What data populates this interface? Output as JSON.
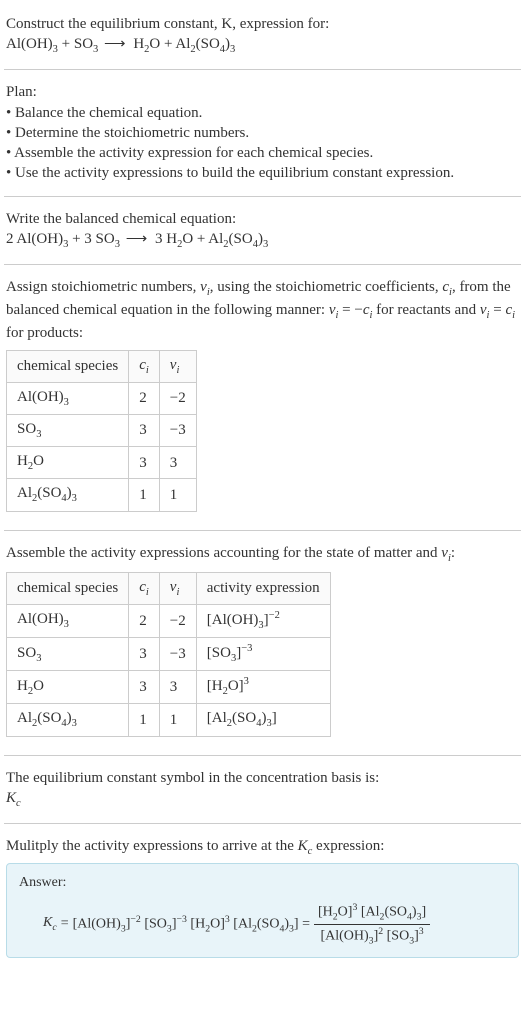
{
  "intro": {
    "line1": "Construct the equilibrium constant, K, expression for:",
    "equation_lhs1": "Al(OH)",
    "equation_lhs1_sub": "3",
    "equation_plus1": " + SO",
    "equation_lhs2_sub": "3",
    "equation_arrow": "  ⟶  ",
    "equation_rhs1": "H",
    "equation_rhs1_sub": "2",
    "equation_rhs1b": "O + Al",
    "equation_rhs2_sub": "2",
    "equation_rhs2b": "(SO",
    "equation_rhs3_sub": "4",
    "equation_rhs3b": ")",
    "equation_rhs4_sub": "3"
  },
  "plan": {
    "title": "Plan:",
    "b1": "• Balance the chemical equation.",
    "b2": "• Determine the stoichiometric numbers.",
    "b3": "• Assemble the activity expression for each chemical species.",
    "b4": "• Use the activity expressions to build the equilibrium constant expression."
  },
  "balanced": {
    "title": "Write the balanced chemical equation:",
    "c1": "2 Al(OH)",
    "s1": "3",
    "c2": " + 3 SO",
    "s2": "3",
    "arrow": "  ⟶  ",
    "c3": "3 H",
    "s3": "2",
    "c4": "O + Al",
    "s4": "2",
    "c5": "(SO",
    "s5": "4",
    "c6": ")",
    "s6": "3"
  },
  "assign": {
    "text1": "Assign stoichiometric numbers, ",
    "nu": "ν",
    "sub_i": "i",
    "text2": ", using the stoichiometric coefficients, ",
    "c": "c",
    "text3": ", from the balanced chemical equation in the following manner: ",
    "eq1": "ν",
    "eq2": " = −",
    "eq3": "c",
    "text4": " for reactants and ",
    "eq4": "ν",
    "eq5": " = ",
    "eq6": "c",
    "text5": " for products:"
  },
  "table1": {
    "h1": "chemical species",
    "h2": "c",
    "h2sub": "i",
    "h3": "ν",
    "h3sub": "i",
    "rows": [
      {
        "sp_a": "Al(OH)",
        "sp_sub": "3",
        "c": "2",
        "nu": "−2"
      },
      {
        "sp_a": "SO",
        "sp_sub": "3",
        "c": "3",
        "nu": "−3"
      },
      {
        "sp_a": "H",
        "sp_sub": "2",
        "sp_b": "O",
        "c": "3",
        "nu": "3"
      },
      {
        "sp_a": "Al",
        "sp_sub": "2",
        "sp_b": "(SO",
        "sp_sub2": "4",
        "sp_c": ")",
        "sp_sub3": "3",
        "c": "1",
        "nu": "1"
      }
    ]
  },
  "assemble": {
    "text": "Assemble the activity expressions accounting for the state of matter and ",
    "nu": "ν",
    "sub_i": "i",
    "colon": ":"
  },
  "table2": {
    "h1": "chemical species",
    "h2": "c",
    "h2sub": "i",
    "h3": "ν",
    "h3sub": "i",
    "h4": "activity expression"
  },
  "eq_const": {
    "text": "The equilibrium constant symbol in the concentration basis is:",
    "k": "K",
    "ksub": "c"
  },
  "multiply": {
    "text1": "Mulitply the activity expressions to arrive at the ",
    "k": "K",
    "ksub": "c",
    "text2": " expression:"
  },
  "answer": {
    "label": "Answer:",
    "k": "K",
    "ksub": "c",
    "eq": " = "
  }
}
